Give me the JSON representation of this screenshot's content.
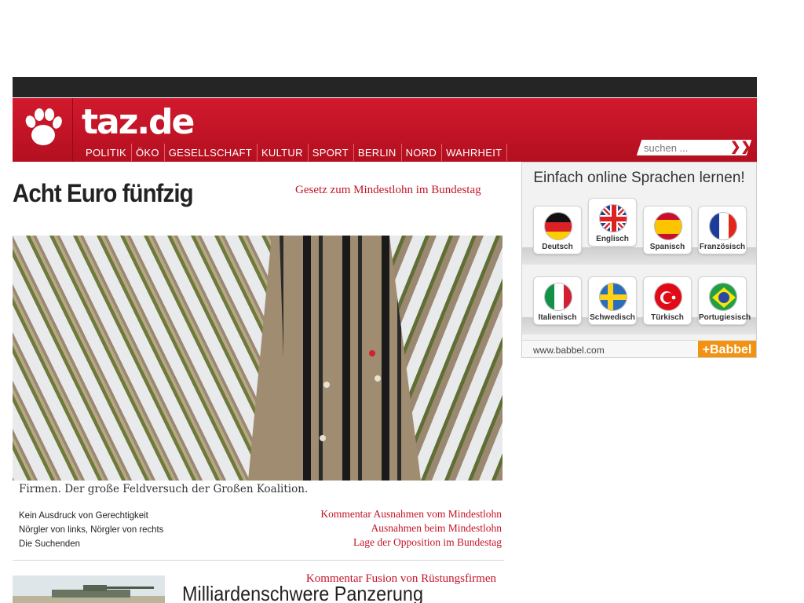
{
  "site": {
    "name": "taz.de",
    "nav": [
      "POLITIK",
      "ÖKO",
      "GESELLSCHAFT",
      "KULTUR",
      "SPORT",
      "BERLIN",
      "NORD",
      "WAHRHEIT"
    ],
    "search_placeholder": "suchen ..."
  },
  "lead": {
    "headline": "Acht Euro fünfzig",
    "kicker": "Gesetz zum Mindestlohn im Bundestag",
    "teaser": "Firmen. Der große Feldversuch der Großen Koalition.",
    "related_left": [
      "Kein Ausdruck von Gerechtigkeit",
      "Nörgler von links, Nörgler von rechts",
      "Die Suchenden"
    ],
    "related_right": [
      "Kommentar Ausnahmen vom Mindestlohn",
      "Ausnahmen beim Mindestlohn",
      "Lage der Opposition im Bundestag"
    ]
  },
  "second": {
    "kicker": "Kommentar Fusion von Rüstungsfirmen",
    "headline": "Milliardenschwere Panzerung"
  },
  "ad": {
    "title": "Einfach online Sprachen lernen!",
    "languages": [
      "Deutsch",
      "Englisch",
      "Spanisch",
      "Französisch",
      "Italienisch",
      "Schwedisch",
      "Türkisch",
      "Portugiesisch"
    ],
    "url": "www.babbel.com",
    "brand": "+Babbel"
  },
  "colors": {
    "brand_red": "#c41426",
    "babbel_orange": "#f39110"
  }
}
